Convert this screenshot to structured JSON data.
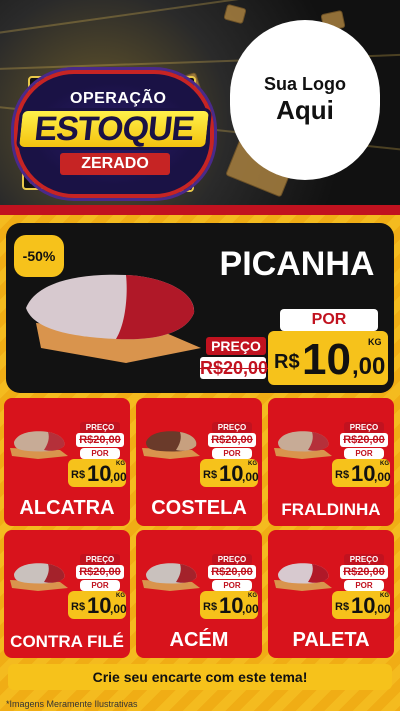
{
  "hero": {
    "operacao": "OPERAÇÃO",
    "estoque": "ESTOQUE",
    "zerado": "ZERADO",
    "coin_symbol": "$"
  },
  "logo": {
    "line1": "Sua Logo",
    "line2": "Aqui"
  },
  "feature": {
    "discount": "-50%",
    "name": "PICANHA",
    "preco_label": "PREÇO",
    "old_price": "R$20,00",
    "por_label": "POR",
    "currency": "R$",
    "price_int": "10",
    "price_cents": ",00",
    "unit": "KG"
  },
  "cards": [
    {
      "name": "ALCATRA",
      "preco_label": "PREÇO",
      "old_price": "R$20,00",
      "por_label": "POR",
      "currency": "R$",
      "price_int": "10",
      "price_cents": ",00",
      "unit": "KG"
    },
    {
      "name": "COSTELA",
      "preco_label": "PREÇO",
      "old_price": "R$20,00",
      "por_label": "POR",
      "currency": "R$",
      "price_int": "10",
      "price_cents": ",00",
      "unit": "KG"
    },
    {
      "name": "FRALDINHA",
      "preco_label": "PREÇO",
      "old_price": "R$20,00",
      "por_label": "POR",
      "currency": "R$",
      "price_int": "10",
      "price_cents": ",00",
      "unit": "KG"
    },
    {
      "name": "CONTRA FILÉ",
      "preco_label": "PREÇO",
      "old_price": "R$20,00",
      "por_label": "POR",
      "currency": "R$",
      "price_int": "10",
      "price_cents": ",00",
      "unit": "KG"
    },
    {
      "name": "ACÉM",
      "preco_label": "PREÇO",
      "old_price": "R$20,00",
      "por_label": "POR",
      "currency": "R$",
      "price_int": "10",
      "price_cents": ",00",
      "unit": "KG"
    },
    {
      "name": "PALETA",
      "preco_label": "PREÇO",
      "old_price": "R$20,00",
      "por_label": "POR",
      "currency": "R$",
      "price_int": "10",
      "price_cents": ",00",
      "unit": "KG"
    }
  ],
  "footer": {
    "cta": "Crie seu encarte com este tema!"
  },
  "note": "*Imagens Meramente Ilustrativas",
  "colors": {
    "red": "#d8131c",
    "yellow": "#f6c21b",
    "dark": "#121212"
  }
}
